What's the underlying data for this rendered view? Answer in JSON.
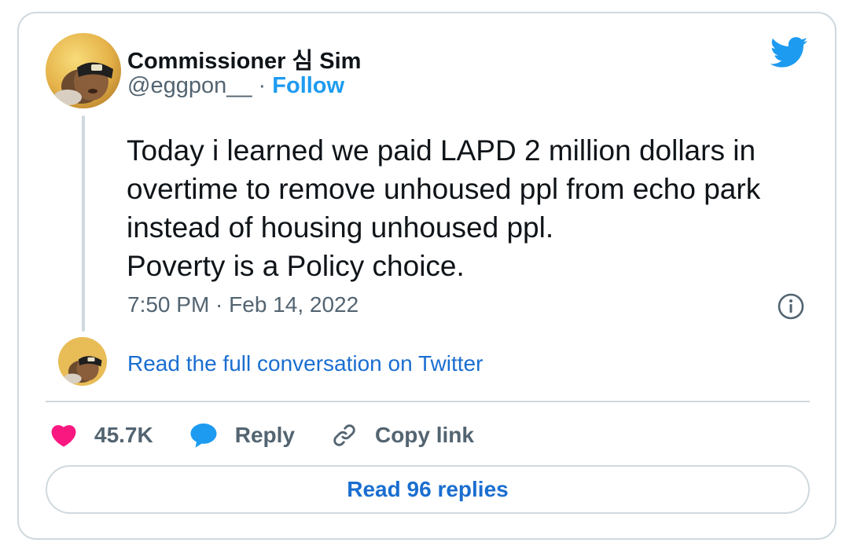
{
  "author": {
    "display_name": "Commissioner 심 Sim",
    "handle": "@eggpon__",
    "separator": "·",
    "follow_label": "Follow"
  },
  "tweet": {
    "lines": [
      "Today i learned we paid LAPD 2 million dollars in",
      "overtime to remove unhoused ppl from echo park",
      "instead of housing unhoused ppl.",
      "Poverty is a Policy choice."
    ],
    "timestamp": "7:50 PM · Feb 14, 2022"
  },
  "conversation_link": "Read the full conversation on Twitter",
  "actions": {
    "like_count": "45.7K",
    "reply_label": "Reply",
    "copy_link_label": "Copy link"
  },
  "read_replies_label": "Read 96 replies",
  "colors": {
    "twitter_blue": "#1d9bf0",
    "link_blue": "#1a6ed0",
    "heart_pink": "#f91880",
    "text_dark": "#0f1419",
    "text_gray": "#536471",
    "border": "#cfd9de"
  },
  "icons": [
    "twitter-bird-icon",
    "info-icon",
    "heart-icon",
    "reply-bubble-icon",
    "link-icon"
  ]
}
